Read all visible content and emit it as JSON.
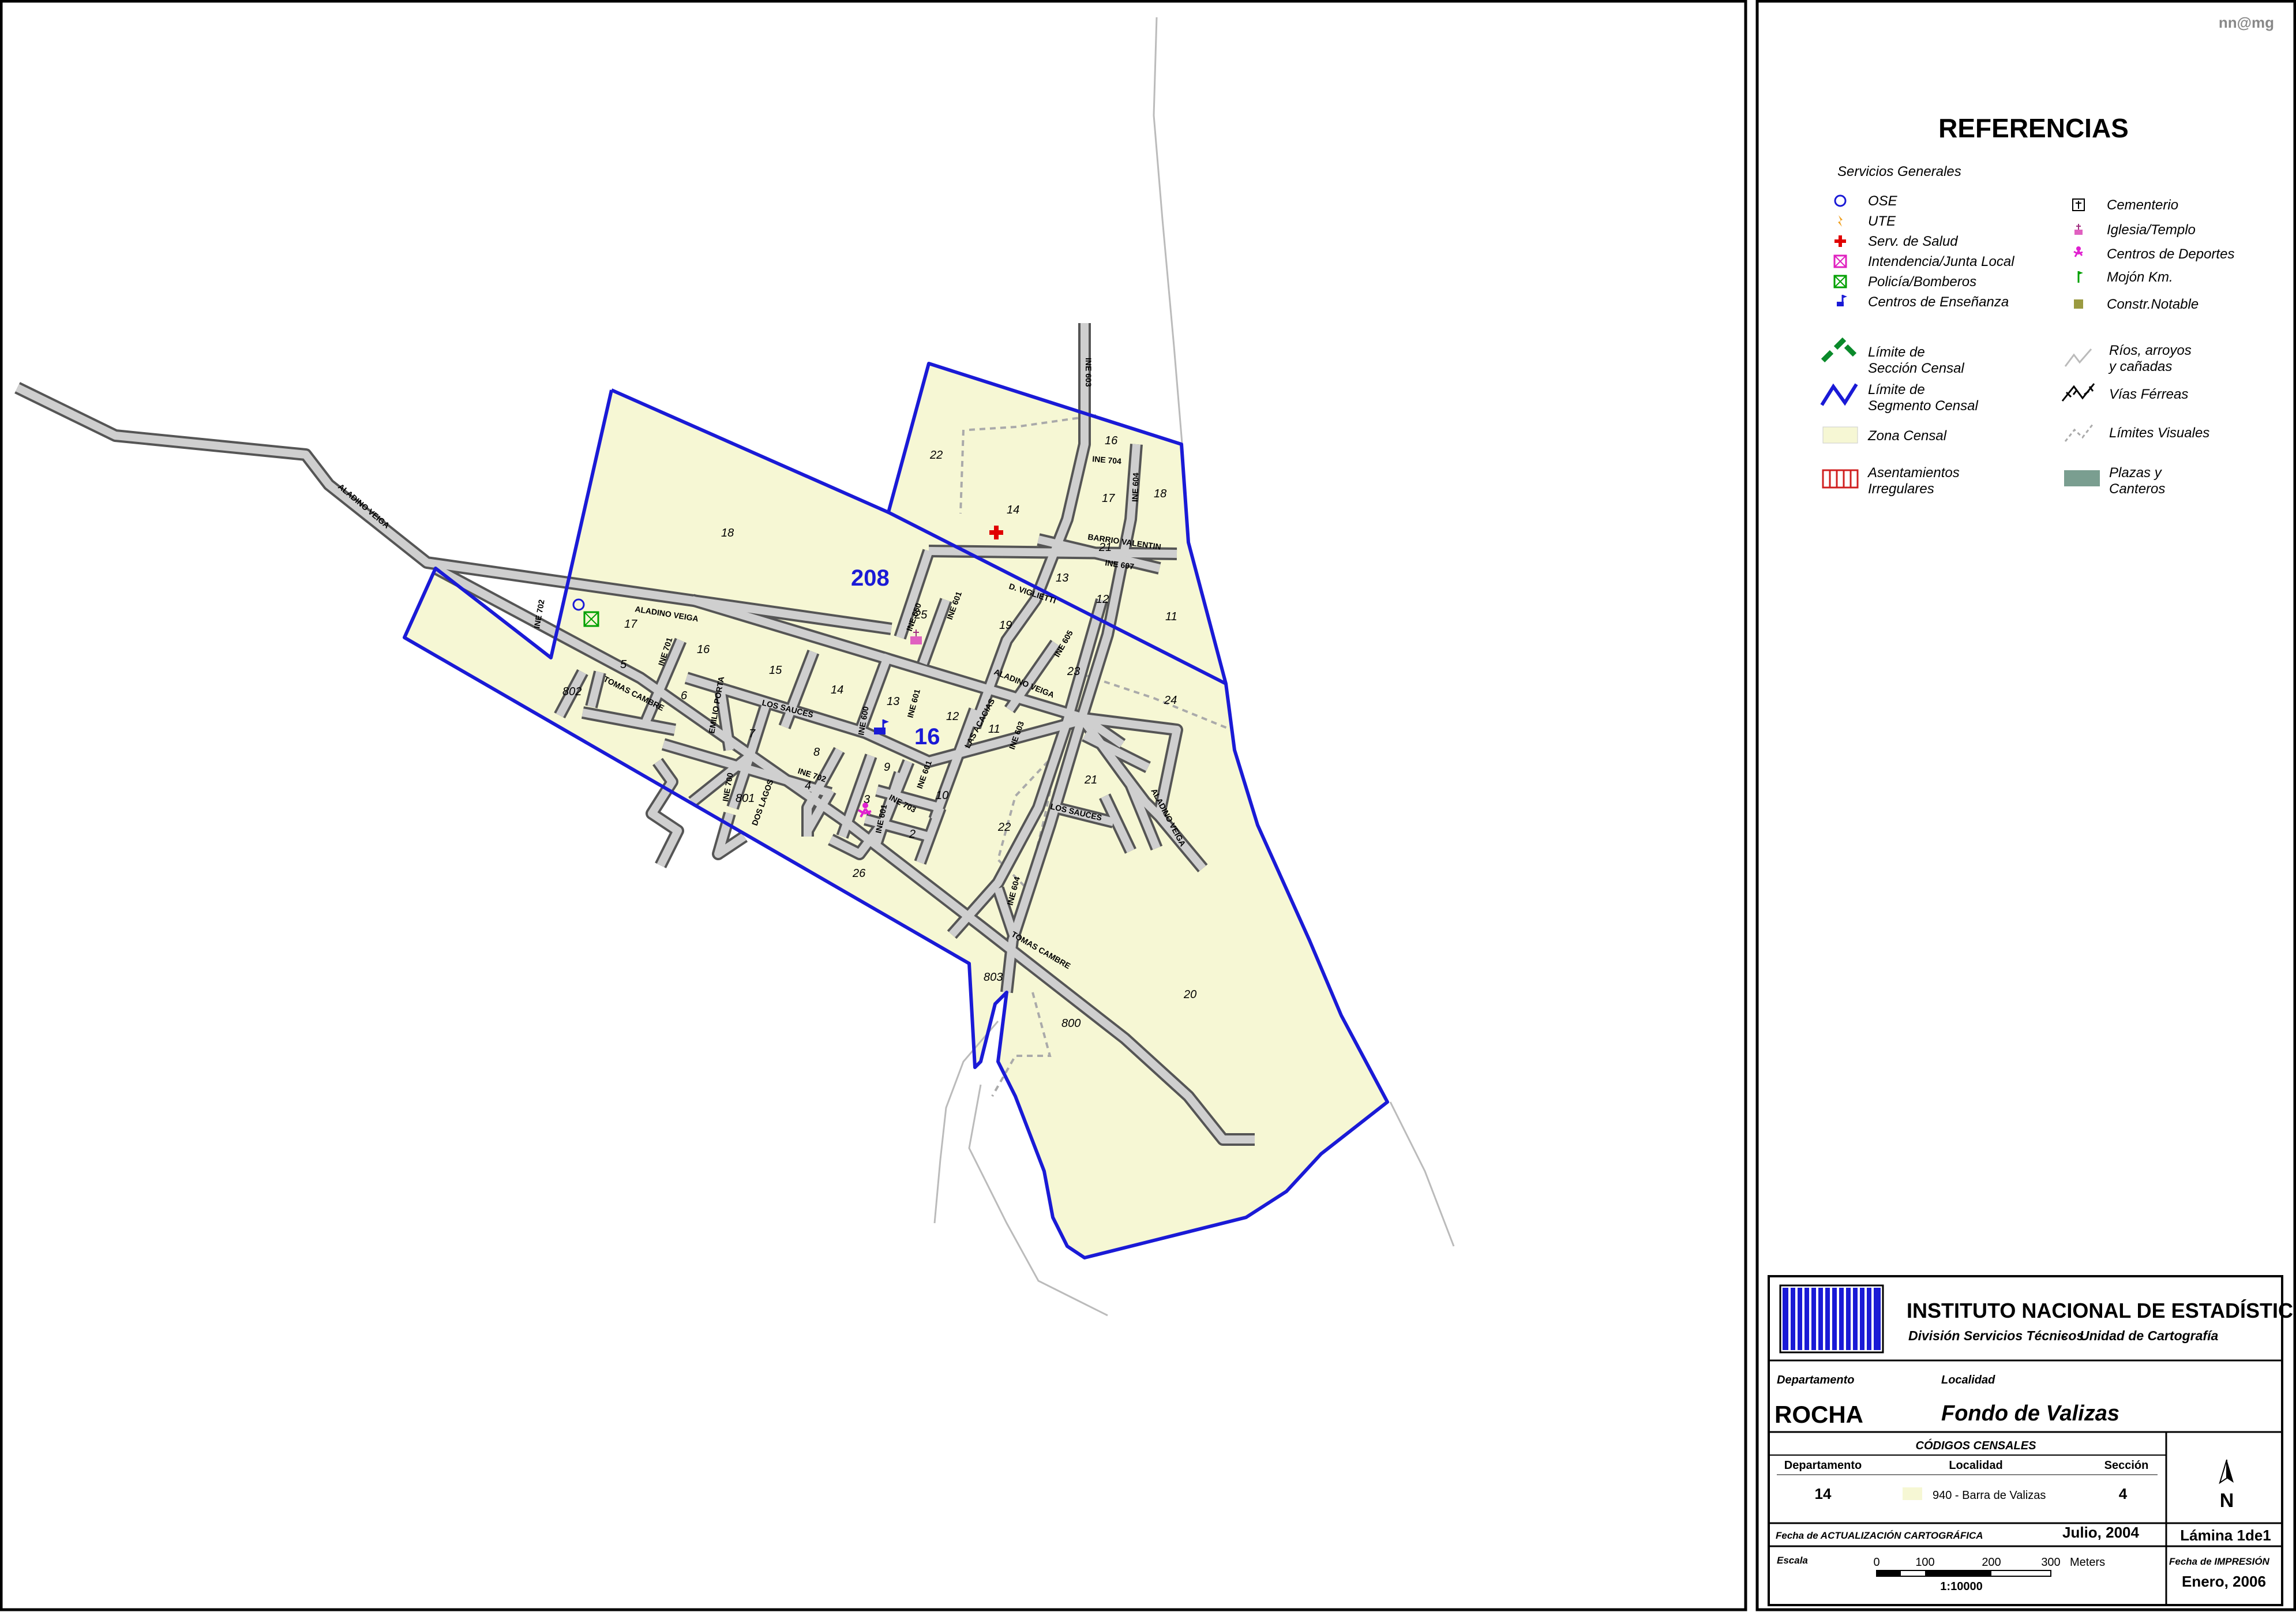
{
  "author": "nn@mg",
  "legend": {
    "title": "REFERENCIAS",
    "services_title": "Servicios Generales",
    "services_left": [
      "OSE",
      "UTE",
      "Serv. de Salud",
      "Intendencia/Junta Local",
      "Policía/Bomberos",
      "Centros de Enseñanza"
    ],
    "services_right": [
      "Cementerio",
      "Iglesia/Templo",
      "Centros de Deportes",
      "Mojón Km.",
      "Constr.Notable"
    ],
    "lines_left": [
      [
        "Límite de",
        "Sección Censal"
      ],
      [
        "Límite de",
        "Segmento Censal"
      ],
      [
        "Zona Censal"
      ],
      [
        "Asentamientos",
        "Irregulares"
      ]
    ],
    "lines_right": [
      [
        "Ríos, arroyos",
        "y cañadas"
      ],
      [
        "Vías Férreas"
      ],
      [
        "Límites  Visuales"
      ],
      [
        "Plazas y",
        "Canteros"
      ]
    ]
  },
  "colors": {
    "zone": "#f6f7d4",
    "segment": "#1a1ad6",
    "road": "#cccccc",
    "road_edge": "#666666"
  },
  "institution": {
    "name": "INSTITUTO NACIONAL DE ESTADÍSTICA",
    "division": "División Servicios Técnicos",
    "sep": "-",
    "unit": "Unidad de Cartografía"
  },
  "title_block": {
    "dept_label": "Departamento",
    "loc_label": "Localidad",
    "dept_value": "ROCHA",
    "loc_value": "Fondo de Valizas",
    "codes_title": "CÓDIGOS CENSALES",
    "code_dept_label": "Departamento",
    "code_loc_label": "Localidad",
    "code_sec_label": "Sección",
    "code_dept": "14",
    "code_loc": "940 - Barra de Valizas",
    "code_sec": "4",
    "sheet": "Lámina 1de1",
    "update_label": "Fecha de ACTUALIZACIÓN CARTOGRÁFICA",
    "update_value": "Julio, 2004",
    "scale_label": "Escala",
    "scale_ticks": [
      "0",
      "100",
      "200",
      "300"
    ],
    "scale_unit": "Meters",
    "scale_ratio": "1:10000",
    "print_label": "Fecha de IMPRESIÓN",
    "print_value": "Enero, 2006",
    "north": "N"
  },
  "map": {
    "segment_labels": [
      "208",
      "16"
    ],
    "block_labels": [
      "22",
      "14",
      "16",
      "17",
      "18",
      "18",
      "21",
      "13",
      "12",
      "11",
      "19",
      "23",
      "24",
      "25",
      "17",
      "16",
      "15",
      "14",
      "13",
      "12",
      "11",
      "5",
      "6",
      "7",
      "8",
      "9",
      "10",
      "4",
      "3",
      "2",
      "801",
      "802",
      "803",
      "22",
      "21",
      "26",
      "800",
      "20"
    ],
    "street_labels": [
      "ALADINO VEIGA",
      "ALADINO VEIGA",
      "ALADINO VEIGA",
      "ALADINO VEIGA",
      "TOMAS CAMBRE",
      "TOMAS CAMBRE",
      "LOS SAUCES",
      "LOS SAUCES",
      "EMILIO PORTA",
      "D. VIGLIETTI",
      "LAS ACACIAS",
      "BARRIO VALENTIN",
      "DOS LAGOS",
      "INE 603",
      "INE 704",
      "INE 604",
      "INE 607",
      "INE 702",
      "INE 701",
      "INE 650",
      "INE 601",
      "INE 605",
      "INE 601",
      "INE 600",
      "INE 603",
      "INE 601",
      "INE 703",
      "INE 700",
      "INE 702",
      "INE 601",
      "INE 604"
    ]
  }
}
